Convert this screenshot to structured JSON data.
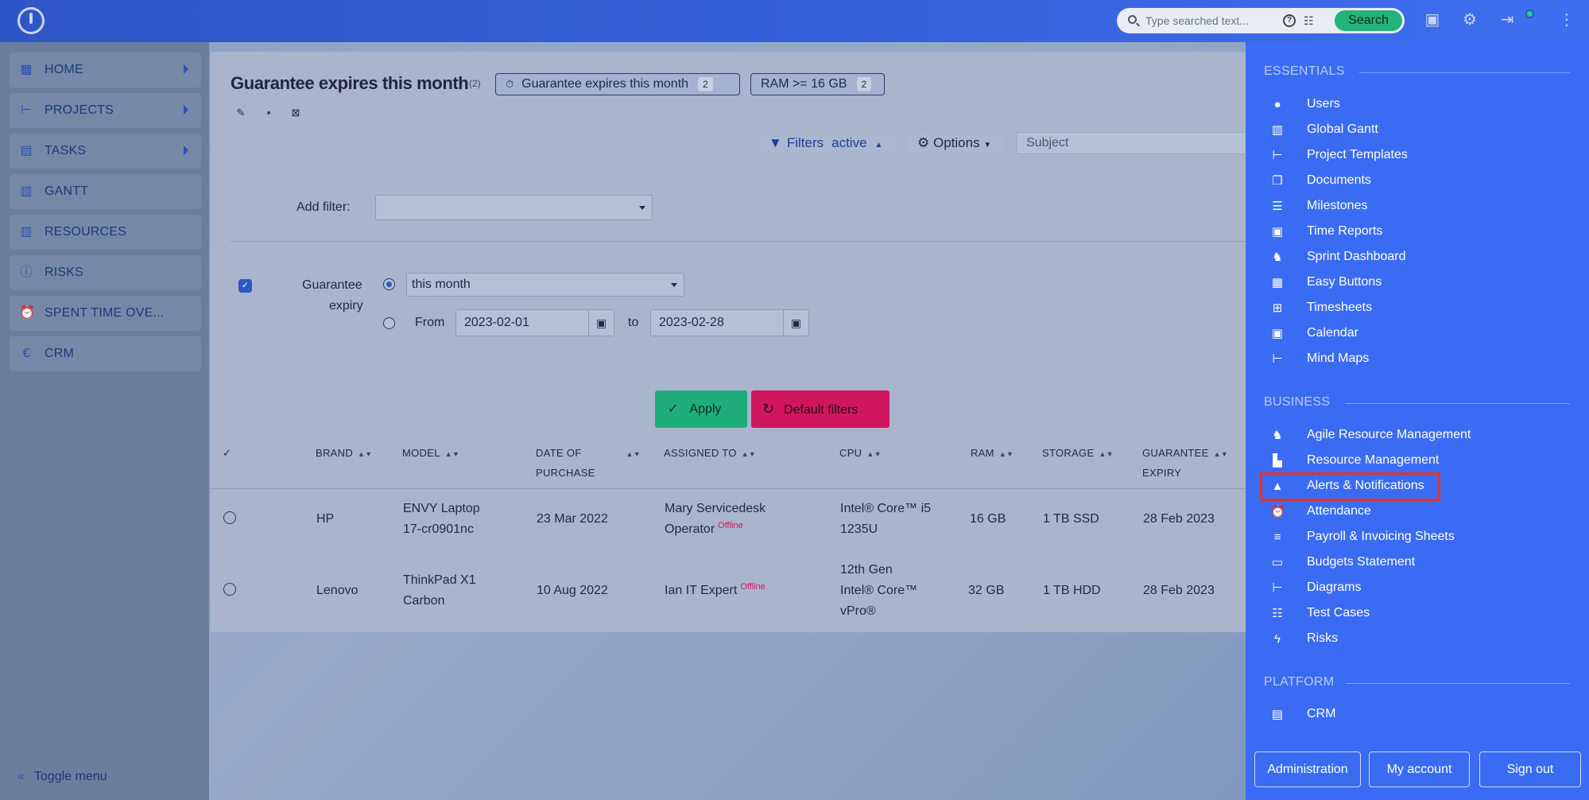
{
  "header": {
    "search_placeholder": "Type searched text...",
    "search_button": "Search"
  },
  "sidebar": {
    "items": [
      {
        "label": "HOME",
        "icon": "dashboard-icon",
        "has_arrow": true
      },
      {
        "label": "PROJECTS",
        "icon": "hierarchy-icon",
        "has_arrow": true
      },
      {
        "label": "TASKS",
        "icon": "clipboard-icon",
        "has_arrow": true
      },
      {
        "label": "GANTT",
        "icon": "bar-chart-icon",
        "has_arrow": false
      },
      {
        "label": "RESOURCES",
        "icon": "bar-chart-icon",
        "has_arrow": false
      },
      {
        "label": "RISKS",
        "icon": "alert-circle-icon",
        "has_arrow": false
      },
      {
        "label": "SPENT TIME OVE...",
        "icon": "alarm-clock-icon",
        "has_arrow": false
      },
      {
        "label": "CRM",
        "icon": "euro-icon",
        "has_arrow": false
      }
    ],
    "toggle_label": "Toggle menu"
  },
  "query": {
    "title": "Guarantee expires this month",
    "count": "(2)",
    "chips": [
      {
        "label": "Guarantee expires this month",
        "count": "2"
      },
      {
        "label": "RAM >= 16 GB",
        "count": "2"
      }
    ],
    "filters_label": "Filters",
    "filters_state": "active",
    "options_label": "Options",
    "subject_placeholder": "Subject",
    "add_filter_label": "Add filter:",
    "filter_name_line1": "Guarantee",
    "filter_name_line2": "expiry",
    "period_value": "this month",
    "from_label": "From",
    "from_value": "2023-02-01",
    "to_label": "to",
    "to_value": "2023-02-28",
    "apply_label": "Apply",
    "default_filters_label": "Default filters"
  },
  "table": {
    "headers": [
      "BRAND",
      "MODEL",
      "DATE OF",
      "PURCHASE",
      "ASSIGNED TO",
      "CPU",
      "RAM",
      "STORAGE",
      "GUARANTEE",
      "EXPIRY"
    ],
    "rows": [
      {
        "brand": "HP",
        "model1": "ENVY Laptop",
        "model2": "17-cr0901nc",
        "date": "23 Mar 2022",
        "assigned1": "Mary Servicedesk",
        "assigned2": "Operator",
        "status": "Offline",
        "cpu1": "Intel® Core™ i5",
        "cpu2": "1235U",
        "cpu3": "",
        "ram": "16 GB",
        "storage": "1 TB SSD",
        "expiry": "28 Feb 2023"
      },
      {
        "brand": "Lenovo",
        "model1": "ThinkPad X1",
        "model2": "Carbon",
        "date": "10 Aug 2022",
        "assigned1": "Ian IT Expert",
        "assigned2": "",
        "status": "Offline",
        "cpu1": "12th Gen",
        "cpu2": "Intel® Core™",
        "cpu3": "vPro®",
        "ram": "32 GB",
        "storage": "1 TB HDD",
        "expiry": "28 Feb 2023"
      }
    ]
  },
  "menu": {
    "essentials_title": "ESSENTIALS",
    "essentials": [
      {
        "label": "Users",
        "icon": "user-icon"
      },
      {
        "label": "Global Gantt",
        "icon": "bar-chart-icon"
      },
      {
        "label": "Project Templates",
        "icon": "hierarchy-icon"
      },
      {
        "label": "Documents",
        "icon": "copy-icon"
      },
      {
        "label": "Milestones",
        "icon": "list-icon"
      },
      {
        "label": "Time Reports",
        "icon": "calendar-icon"
      },
      {
        "label": "Sprint Dashboard",
        "icon": "runner-icon"
      },
      {
        "label": "Easy Buttons",
        "icon": "buttons-grid-icon"
      },
      {
        "label": "Timesheets",
        "icon": "table-icon"
      },
      {
        "label": "Calendar",
        "icon": "calendar-icon"
      },
      {
        "label": "Mind Maps",
        "icon": "hierarchy-icon"
      }
    ],
    "business_title": "BUSINESS",
    "business": [
      {
        "label": "Agile Resource Management",
        "icon": "runner-icon"
      },
      {
        "label": "Resource Management",
        "icon": "chart-icon"
      },
      {
        "label": "Alerts & Notifications",
        "icon": "warning-icon"
      },
      {
        "label": "Attendance",
        "icon": "alarm-clock-icon"
      },
      {
        "label": "Payroll & Invoicing Sheets",
        "icon": "list-check-icon"
      },
      {
        "label": "Budgets Statement",
        "icon": "money-icon"
      },
      {
        "label": "Diagrams",
        "icon": "hierarchy-icon"
      },
      {
        "label": "Test Cases",
        "icon": "checklist-icon"
      },
      {
        "label": "Risks",
        "icon": "lightning-icon"
      }
    ],
    "platform_title": "PLATFORM",
    "platform": [
      {
        "label": "CRM",
        "icon": "contact-badge-icon"
      }
    ],
    "footer": {
      "administration": "Administration",
      "my_account": "My account",
      "sign_out": "Sign out"
    }
  },
  "colors": {
    "accent": "#3a6cf3",
    "apply": "#1fae7b",
    "default": "#d0175e",
    "highlight": "#e0332f"
  }
}
